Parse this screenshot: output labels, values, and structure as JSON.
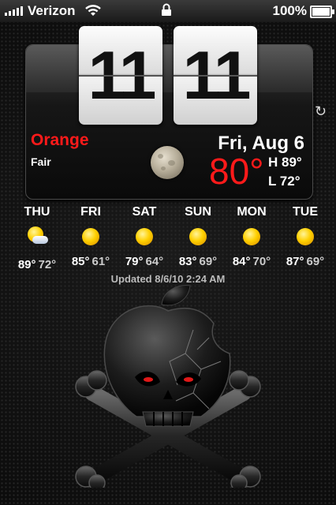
{
  "status_bar": {
    "carrier": "Verizon",
    "battery_percent": "100%",
    "signal_icon": "signal-bars-icon",
    "wifi_icon": "wifi-icon",
    "lock_icon": "lock-icon"
  },
  "clock": {
    "hours": "11",
    "minutes": "11"
  },
  "weather": {
    "location": "Orange",
    "condition": "Fair",
    "date": "Fri, Aug 6",
    "current_temp": "80°",
    "high": "H 89°",
    "low": "L 72°",
    "moon_icon": "full-moon-icon",
    "refresh_icon": "refresh-icon",
    "location_color": "#ff1a1a"
  },
  "forecast": [
    {
      "day": "THU",
      "high": "89°",
      "low": "72°",
      "icon": "partly-sunny-icon"
    },
    {
      "day": "FRI",
      "high": "85°",
      "low": "61°",
      "icon": "sun-icon"
    },
    {
      "day": "SAT",
      "high": "79°",
      "low": "64°",
      "icon": "sun-icon"
    },
    {
      "day": "SUN",
      "high": "83°",
      "low": "69°",
      "icon": "sun-icon"
    },
    {
      "day": "MON",
      "high": "84°",
      "low": "70°",
      "icon": "sun-icon"
    },
    {
      "day": "TUE",
      "high": "87°",
      "low": "69°",
      "icon": "sun-icon"
    }
  ],
  "updated": "Updated 8/6/10 2:24 AM",
  "wallpaper": {
    "art": "pirate-apple-skull-crossbones-art"
  }
}
